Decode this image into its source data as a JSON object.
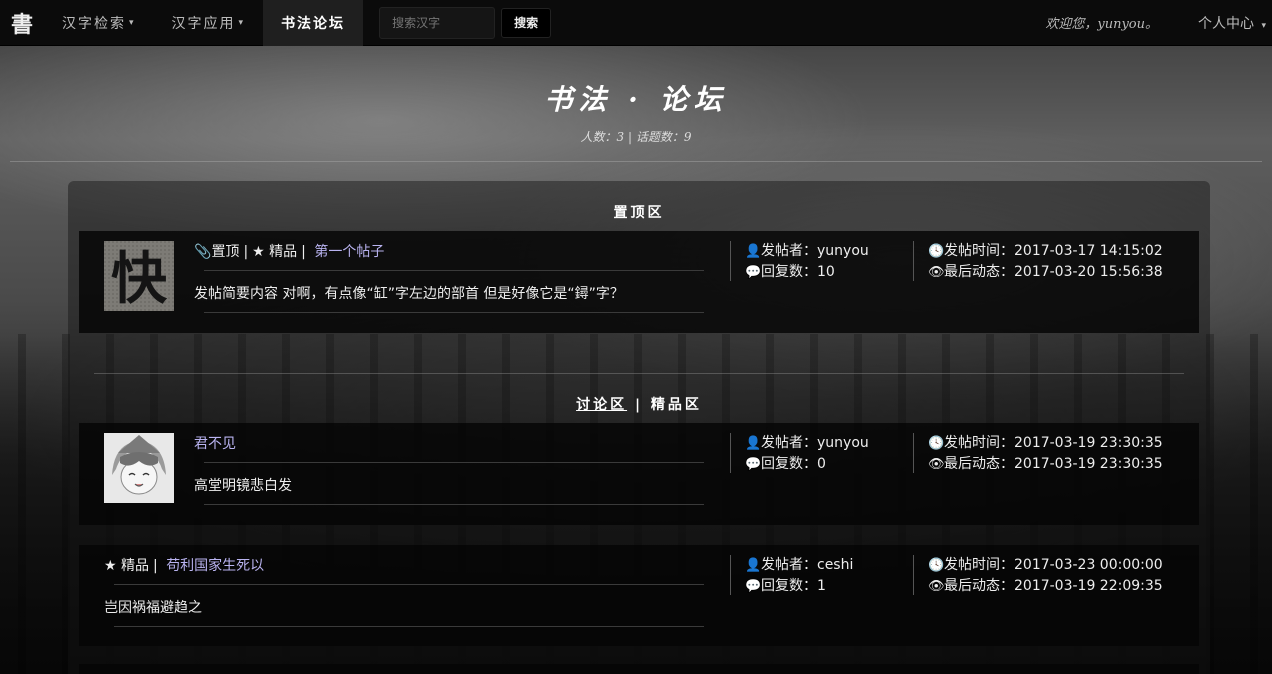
{
  "navbar": {
    "brand": "書",
    "items": [
      {
        "label": "汉字检索",
        "caret": "▾"
      },
      {
        "label": "汉字应用",
        "caret": "▾"
      },
      {
        "label": "书法论坛"
      }
    ],
    "search_placeholder": "搜索汉字",
    "search_button": "搜索",
    "welcome": "欢迎您，yunyou。",
    "user_center": "个人中心",
    "user_center_caret": "▾"
  },
  "header": {
    "title": "书法 · 论坛",
    "stats": "人数：3 | 话题数：9"
  },
  "sections": {
    "pinned_title": "置顶区",
    "discussion_title": "讨论区",
    "title_sep": "|",
    "featured_title": "精品区"
  },
  "labels": {
    "poster": "发帖者：",
    "replies": "回复数：",
    "post_time": "发帖时间：",
    "last_activity": "最后动态："
  },
  "posts": [
    {
      "avatar_char": "快",
      "tags": [
        "置顶",
        "精品"
      ],
      "title": "第一个帖子",
      "summary": "发帖简要内容 对啊，有点像“缸”字左边的部首 但是好像它是“鐞”字？",
      "poster": "yunyou",
      "replies": "10",
      "post_time": "2017-03-17 14:15:02",
      "last_activity": "2017-03-20 15:56:38"
    },
    {
      "tags": [],
      "title": "君不见",
      "summary": "高堂明镜悲白发",
      "poster": "yunyou",
      "replies": "0",
      "post_time": "2017-03-19 23:30:35",
      "last_activity": "2017-03-19 23:30:35"
    },
    {
      "tags": [
        "精品"
      ],
      "title": "苟利国家生死以",
      "summary": "岂因祸福避趋之",
      "poster": "ceshi",
      "replies": "1",
      "post_time": "2017-03-23 00:00:00",
      "last_activity": "2017-03-19 22:09:35"
    }
  ],
  "colors": {
    "link": "#b9b3f0",
    "navbar_bg": "#0b0b0b",
    "post_bg": "#050505"
  },
  "icons": {
    "pin": "paperclip-icon",
    "featured": "star-icon",
    "poster": "user-icon",
    "replies": "comment-icon",
    "post_time": "clock-icon",
    "last_activity": "eye-icon"
  }
}
